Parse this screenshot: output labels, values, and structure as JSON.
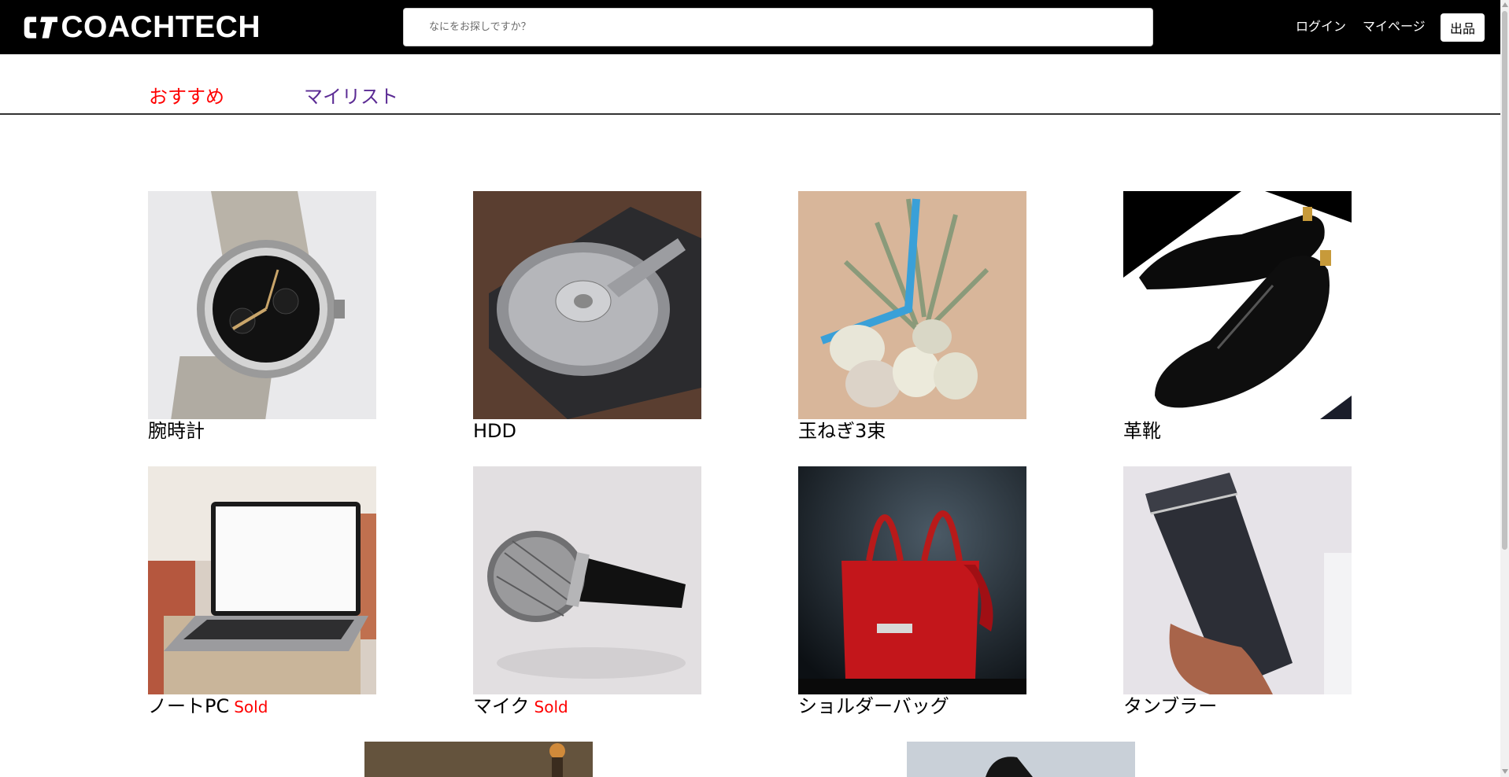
{
  "header": {
    "logo_text": "COACHTECH",
    "search_placeholder": "なにをお探しですか？",
    "login_label": "ログイン",
    "mypage_label": "マイページ",
    "sell_label": "出品"
  },
  "tabs": {
    "recommend_label": "おすすめ",
    "mylist_label": "マイリスト",
    "active_color": "#ff0000",
    "inactive_color": "#5b2b94"
  },
  "items": [
    {
      "name": "腕時計",
      "sold": "",
      "icon": "wristwatch-image"
    },
    {
      "name": "HDD",
      "sold": "",
      "icon": "hard-disk-image"
    },
    {
      "name": "玉ねぎ3束",
      "sold": "",
      "icon": "onion-bundle-image"
    },
    {
      "name": "革靴",
      "sold": "",
      "icon": "leather-shoes-image"
    },
    {
      "name": "ノートPC",
      "sold": "Sold",
      "icon": "laptop-image"
    },
    {
      "name": "マイク",
      "sold": "Sold",
      "icon": "microphone-image"
    },
    {
      "name": "ショルダーバッグ",
      "sold": "",
      "icon": "shoulder-bag-image"
    },
    {
      "name": "タンブラー",
      "sold": "",
      "icon": "tumbler-image"
    }
  ],
  "colors": {
    "header_bg": "#000000",
    "sold": "#ff0000"
  }
}
